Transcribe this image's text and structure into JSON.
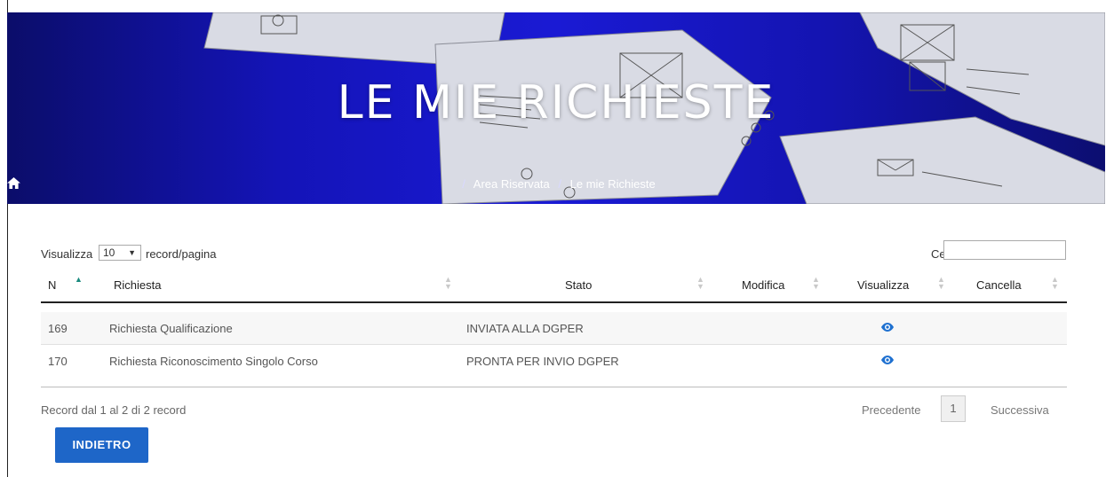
{
  "header": {
    "title": "LE MIE RICHIESTE",
    "breadcrumb": [
      "Area Riservata",
      "Le mie Richieste"
    ],
    "home_icon": "home-icon"
  },
  "toolbar": {
    "length_label": "Visualizza",
    "length_value": "10",
    "length_suffix": "record/pagina",
    "search_label": "Cerca:",
    "search_value": ""
  },
  "table": {
    "columns": [
      "N",
      "Richiesta",
      "Stato",
      "Modifica",
      "Visualizza",
      "Cancella"
    ],
    "rows": [
      {
        "n": "169",
        "richiesta": "Richiesta Qualificazione",
        "stato": "INVIATA ALLA DGPER",
        "visualizza_icon": "eye-icon"
      },
      {
        "n": "170",
        "richiesta": "Richiesta Riconoscimento Singolo Corso",
        "stato": "PRONTA PER INVIO DGPER",
        "visualizza_icon": "eye-icon"
      }
    ]
  },
  "footer": {
    "info": "Record dal 1 al 2 di 2 record",
    "pagination": {
      "prev": "Precedente",
      "current": "1",
      "next": "Successiva"
    },
    "back_button": "INDIETRO"
  },
  "colors": {
    "hero_blue": "#1a1ad4",
    "primary_button": "#1e66c8",
    "eye_icon": "#1e70d0",
    "sort_active": "#1a8a7e"
  }
}
